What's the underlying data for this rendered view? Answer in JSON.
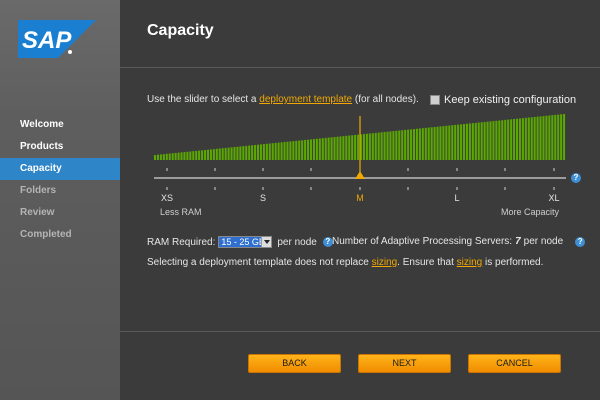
{
  "brand": {
    "logo_text": "SAP",
    "color": "#1a7fd0"
  },
  "sidebar": {
    "items": [
      {
        "label": "Welcome",
        "state": "done"
      },
      {
        "label": "Products",
        "state": "done"
      },
      {
        "label": "Capacity",
        "state": "active"
      },
      {
        "label": "Folders",
        "state": "disabled"
      },
      {
        "label": "Review",
        "state": "disabled"
      },
      {
        "label": "Completed",
        "state": "disabled"
      }
    ]
  },
  "page": {
    "title": "Capacity"
  },
  "instruction": {
    "prefix": "Use the slider to select a ",
    "link": "deployment template",
    "suffix": " (for all nodes)."
  },
  "keep_existing": {
    "label": "Keep existing configuration",
    "checked": false
  },
  "slider": {
    "sizes": [
      "XS",
      "S",
      "M",
      "L",
      "XL"
    ],
    "selected": "M",
    "min_label": "Less RAM",
    "max_label": "More Capacity",
    "bar_color": "#5aa800",
    "marker_color": "#f0a800"
  },
  "ram": {
    "label": "RAM Required:",
    "value": "15 - 25 GB",
    "unit": "per node"
  },
  "servers": {
    "label": "Number of Adaptive Processing Servers:",
    "value": "7",
    "unit": "per node"
  },
  "note": {
    "part1": "Selecting a deployment template does not replace ",
    "link1": "sizing",
    "part2": ". Ensure that ",
    "link2": "sizing",
    "part3": " is performed."
  },
  "buttons": {
    "back": "BACK",
    "next": "NEXT",
    "cancel": "CANCEL"
  },
  "help_icon_glyph": "?"
}
